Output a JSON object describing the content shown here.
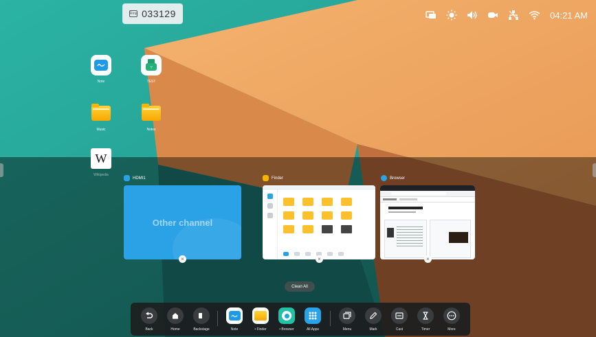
{
  "top_chip": {
    "icon": "display-id-icon",
    "icon_text": "Rmp",
    "code": "033129"
  },
  "status_bar": {
    "icons": [
      "screen-share-icon",
      "brightness-icon",
      "volume-icon",
      "camera-icon",
      "network-icon",
      "wifi-icon"
    ],
    "time": "04:21 AM"
  },
  "desktop_icons": [
    {
      "label": "Note",
      "icon": "note-app-icon"
    },
    {
      "label": "TEST",
      "icon": "usb-drive-icon"
    },
    {
      "label": "Music",
      "icon": "folder-icon"
    },
    {
      "label": "Notes",
      "icon": "folder-icon"
    },
    {
      "label": "Wikipedia",
      "icon": "wikipedia-icon",
      "glyph": "W"
    }
  ],
  "recent_apps": [
    {
      "title": "HDMI1",
      "preview_text": "Other channel",
      "icon_color": "#2ba2e6"
    },
    {
      "title": "Finder",
      "icon_color": "#f7b400"
    },
    {
      "title": "Browser",
      "icon_color": "#2aa3e6"
    }
  ],
  "clean_all_label": "Clean All",
  "dock": {
    "left": [
      {
        "label": "Back",
        "icon": "back-icon"
      },
      {
        "label": "Home",
        "icon": "home-icon"
      },
      {
        "label": "Backstage",
        "icon": "backstage-icon"
      }
    ],
    "apps": [
      {
        "label": "Note",
        "icon": "note-app-icon"
      },
      {
        "label": "• Finder",
        "icon": "finder-icon"
      },
      {
        "label": "• Browser",
        "icon": "browser-icon"
      },
      {
        "label": "All Apps",
        "icon": "all-apps-icon"
      }
    ],
    "right": [
      {
        "label": "Menu",
        "icon": "menu-icon"
      },
      {
        "label": "Mark",
        "icon": "pen-icon"
      },
      {
        "label": "Cast",
        "icon": "cast-icon"
      },
      {
        "label": "Timer",
        "icon": "hourglass-icon"
      },
      {
        "label": "More",
        "icon": "more-icon"
      }
    ]
  },
  "colors": {
    "accent": "#2aa3e6",
    "wall_teal": "#2aa89a",
    "wall_orange": "#f0ad6a"
  }
}
